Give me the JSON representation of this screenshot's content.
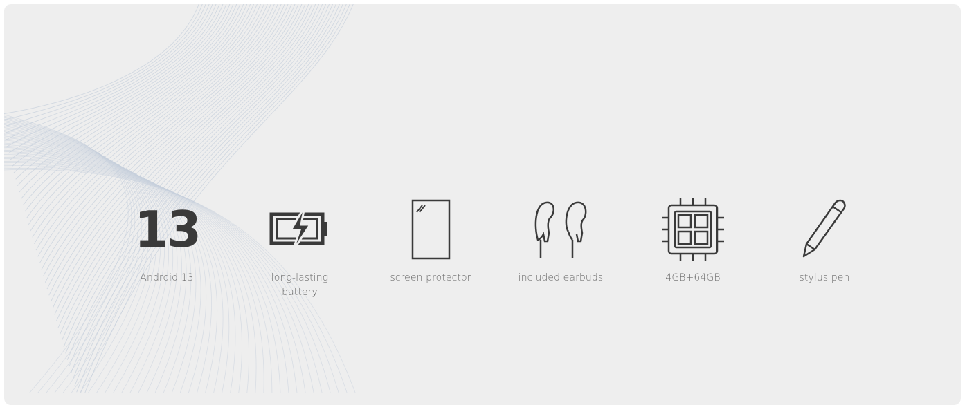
{
  "features": [
    {
      "icon": "android-13-number",
      "value": "13",
      "label": "Android 13"
    },
    {
      "icon": "battery-icon",
      "label": "long-lasting battery"
    },
    {
      "icon": "screen-protector-icon",
      "label": "screen protector"
    },
    {
      "icon": "earbuds-icon",
      "label": "included earbuds"
    },
    {
      "icon": "chip-icon",
      "label": "4GB+64GB"
    },
    {
      "icon": "pencil-icon",
      "label": "stylus pen"
    }
  ],
  "colors": {
    "background": "#eeeeee",
    "icon": "#3a3a3a",
    "label": "#6a6a6a",
    "wave_lines": "#c7d0dc"
  }
}
